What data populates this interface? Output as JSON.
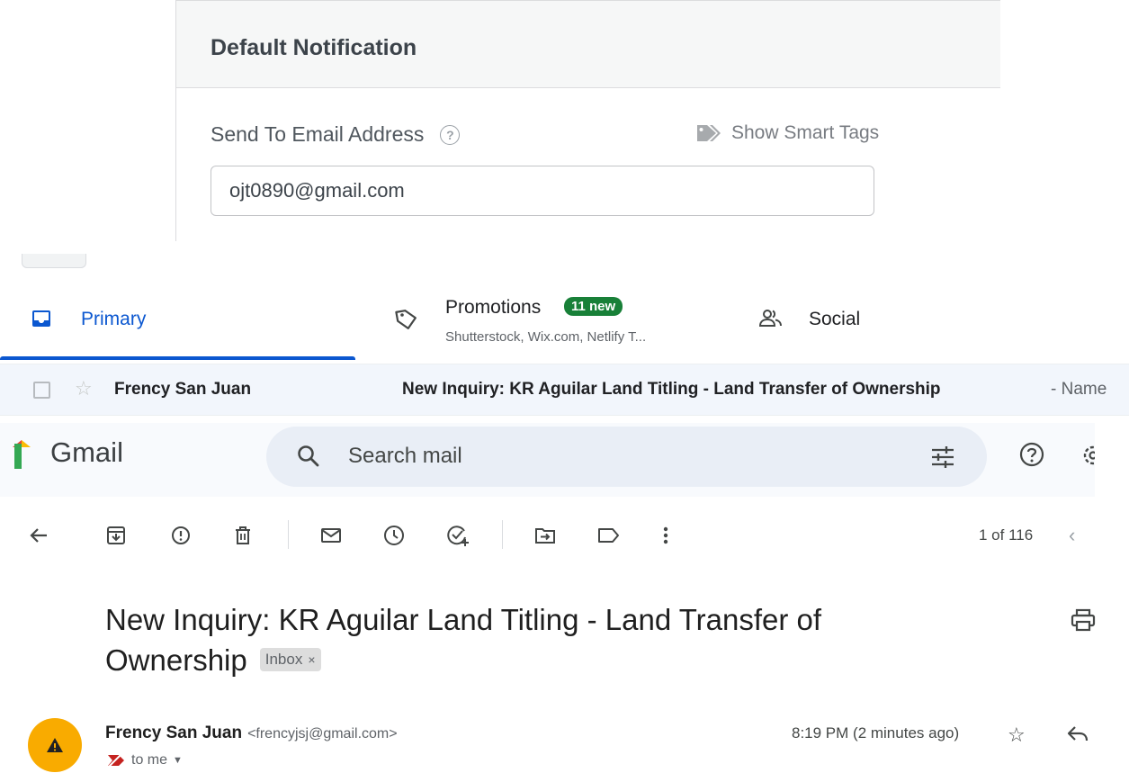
{
  "notification": {
    "title": "Default Notification",
    "send_to_label": "Send To Email Address",
    "help_glyph": "?",
    "smart_tags_label": "Show Smart Tags",
    "email_value": "ojt0890@gmail.com"
  },
  "inbox": {
    "tabs": [
      {
        "label": "Primary",
        "icon": "inbox-icon",
        "active": true
      },
      {
        "label": "Promotions",
        "icon": "tag-icon",
        "badge": "11 new",
        "sub": "Shutterstock, Wix.com, Netlify T..."
      },
      {
        "label": "Social",
        "icon": "people-icon"
      }
    ],
    "row": {
      "sender": "Frency San Juan",
      "subject": "New Inquiry: KR Aguilar Land Titling - Land Transfer of Ownership",
      "snippet": " - Name"
    }
  },
  "gmail": {
    "logo_text": "Gmail",
    "search_placeholder": "Search mail",
    "pager": "1 of 116",
    "email": {
      "subject": "New Inquiry: KR Aguilar Land Titling - Land Transfer of Ownership",
      "label_chip": "Inbox",
      "chip_close": "×",
      "sender_name": "Frency San Juan",
      "sender_email": "<frencyjsj@gmail.com>",
      "recipient": "to me",
      "time": "8:19 PM (2 minutes ago)"
    }
  },
  "colors": {
    "primary_blue": "#0b57d0",
    "promo_badge": "#188038",
    "avatar": "#f9ab00",
    "row_bg": "#f2f6fc"
  }
}
